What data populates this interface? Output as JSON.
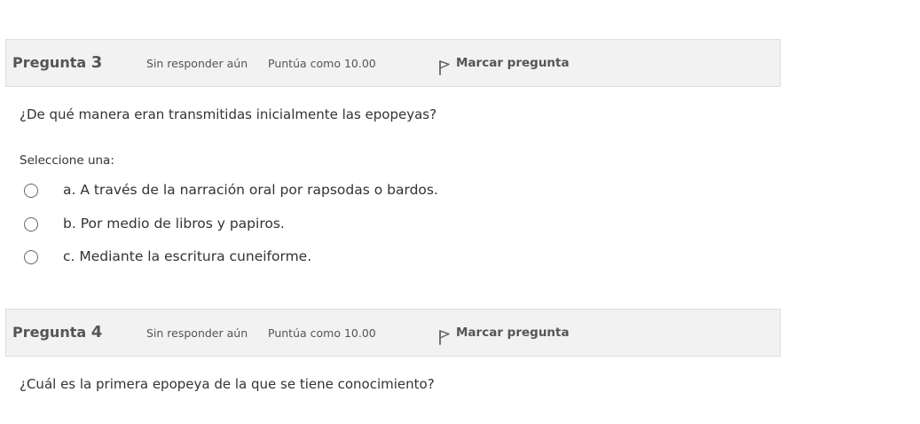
{
  "questions": [
    {
      "label": "Pregunta",
      "number": "3",
      "state": "Sin responder aún",
      "grade": "Puntúa como 10.00",
      "flag_label": "Marcar pregunta",
      "text": "¿De qué manera eran transmitidas inicialmente las epopeyas?",
      "prompt": "Seleccione una:",
      "options": [
        {
          "label": "a. A través de la narración oral por rapsodas o bardos.",
          "selected": false
        },
        {
          "label": "b. Por medio de libros y papiros.",
          "selected": false
        },
        {
          "label": "c. Mediante la escritura cuneiforme.",
          "selected": false
        }
      ]
    },
    {
      "label": "Pregunta",
      "number": "4",
      "state": "Sin responder aún",
      "grade": "Puntúa como 10.00",
      "flag_label": "Marcar pregunta",
      "text": "¿Cuál es la primera epopeya de la que se tiene conocimiento?"
    }
  ],
  "icons": {
    "flag": "flag-icon"
  },
  "colors": {
    "header_bg": "#f2f2f2",
    "header_border": "#dddddd",
    "text": "#333333",
    "muted_text": "#555555"
  }
}
